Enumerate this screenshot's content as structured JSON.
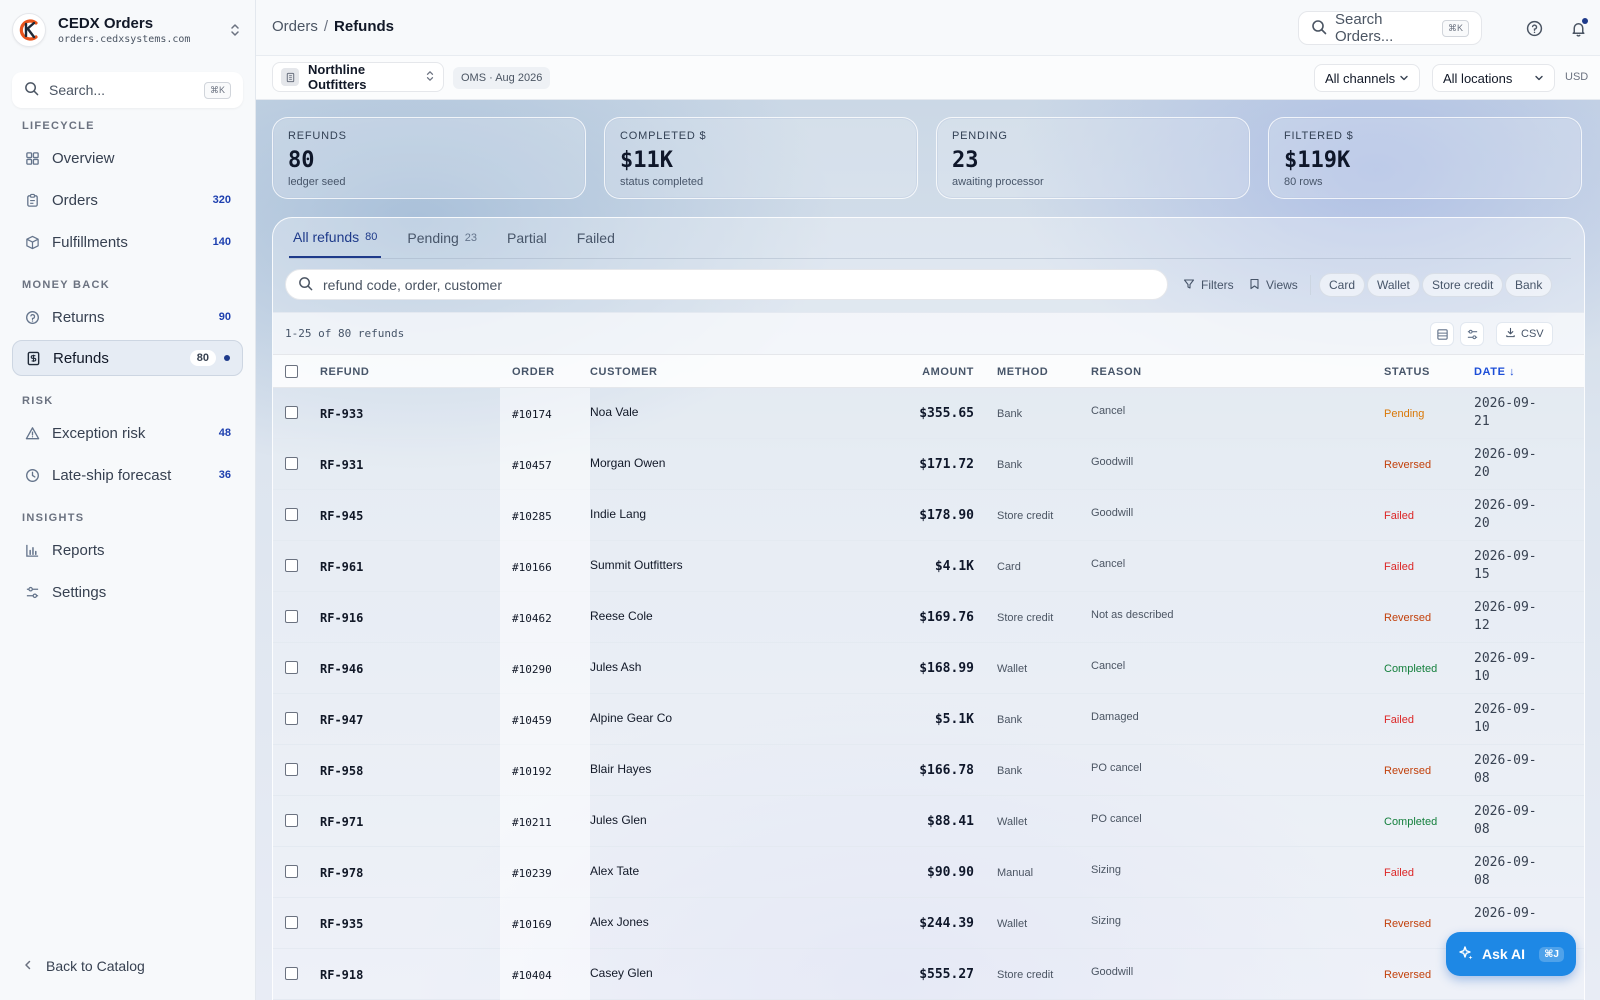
{
  "brand": {
    "name": "CEDX Orders",
    "domain": "orders.cedxsystems.com",
    "accent": "#e8541c"
  },
  "sidebar": {
    "search": {
      "placeholder": "Search...",
      "shortcut": "⌘K"
    },
    "sections": {
      "lifecycle": "LIFECYCLE",
      "money_back": "MONEY BACK",
      "risk": "RISK",
      "insights": "INSIGHTS"
    },
    "items": [
      {
        "label": "Overview",
        "count": "",
        "icon": "grid-icon"
      },
      {
        "label": "Orders",
        "count": "320",
        "icon": "clipboard-icon"
      },
      {
        "label": "Fulfillments",
        "count": "140",
        "icon": "box-icon"
      },
      {
        "label": "Returns",
        "count": "90",
        "icon": "return-circle-icon"
      },
      {
        "label": "Refunds",
        "count": "80",
        "icon": "receipt-dollar-icon",
        "active": true
      },
      {
        "label": "Exception risk",
        "count": "48",
        "icon": "warning-triangle-icon"
      },
      {
        "label": "Late-ship forecast",
        "count": "36",
        "icon": "clock-icon"
      },
      {
        "label": "Reports",
        "count": "",
        "icon": "bar-chart-icon"
      },
      {
        "label": "Settings",
        "count": "",
        "icon": "sliders-icon"
      }
    ],
    "back_label": "Back to Catalog"
  },
  "topbar": {
    "breadcrumb_parent": "Orders",
    "breadcrumb_sep": "/",
    "breadcrumb_current": "Refunds",
    "search_placeholder": "Search Orders...",
    "search_shortcut": "⌘K"
  },
  "subbar": {
    "org": "Northline Outfitters",
    "badge": "OMS · Aug 2026",
    "channels": "All channels",
    "locations": "All locations",
    "currency": "USD"
  },
  "kpis": [
    {
      "label": "REFUNDS",
      "value": "80",
      "sub": "ledger seed"
    },
    {
      "label": "COMPLETED $",
      "value": "$11K",
      "sub": "status completed"
    },
    {
      "label": "PENDING",
      "value": "23",
      "sub": "awaiting processor"
    },
    {
      "label": "FILTERED $",
      "value": "$119K",
      "sub": "80 rows"
    }
  ],
  "tabs": [
    {
      "label": "All refunds",
      "count": "80",
      "active": true
    },
    {
      "label": "Pending",
      "count": "23"
    },
    {
      "label": "Partial",
      "count": ""
    },
    {
      "label": "Failed",
      "count": ""
    }
  ],
  "table_controls": {
    "search_placeholder": "refund code, order, customer",
    "filters_label": "Filters",
    "views_label": "Views",
    "chips": [
      "Card",
      "Wallet",
      "Store credit",
      "Bank"
    ],
    "range_text": "1-25 of 80 refunds",
    "csv_label": "CSV"
  },
  "table": {
    "columns": {
      "refund": "REFUND",
      "order": "ORDER",
      "customer": "CUSTOMER",
      "amount": "AMOUNT",
      "method": "METHOD",
      "reason": "REASON",
      "status": "STATUS",
      "date": "DATE ↓"
    },
    "rows": [
      {
        "refund": "RF-933",
        "order": "#10174",
        "customer": "Noa Vale",
        "amount": "$355.65",
        "method": "Bank",
        "reason": "Cancel",
        "status": "Pending",
        "date": "2026-09-21"
      },
      {
        "refund": "RF-931",
        "order": "#10457",
        "customer": "Morgan Owen",
        "amount": "$171.72",
        "method": "Bank",
        "reason": "Goodwill",
        "status": "Reversed",
        "date": "2026-09-20"
      },
      {
        "refund": "RF-945",
        "order": "#10285",
        "customer": "Indie Lang",
        "amount": "$178.90",
        "method": "Store credit",
        "reason": "Goodwill",
        "status": "Failed",
        "date": "2026-09-20"
      },
      {
        "refund": "RF-961",
        "order": "#10166",
        "customer": "Summit Outfitters",
        "amount": "$4.1K",
        "method": "Card",
        "reason": "Cancel",
        "status": "Failed",
        "date": "2026-09-15"
      },
      {
        "refund": "RF-916",
        "order": "#10462",
        "customer": "Reese Cole",
        "amount": "$169.76",
        "method": "Store credit",
        "reason": "Not as described",
        "status": "Reversed",
        "date": "2026-09-12"
      },
      {
        "refund": "RF-946",
        "order": "#10290",
        "customer": "Jules Ash",
        "amount": "$168.99",
        "method": "Wallet",
        "reason": "Cancel",
        "status": "Completed",
        "date": "2026-09-10"
      },
      {
        "refund": "RF-947",
        "order": "#10459",
        "customer": "Alpine Gear Co",
        "amount": "$5.1K",
        "method": "Bank",
        "reason": "Damaged",
        "status": "Failed",
        "date": "2026-09-10"
      },
      {
        "refund": "RF-958",
        "order": "#10192",
        "customer": "Blair Hayes",
        "amount": "$166.78",
        "method": "Bank",
        "reason": "PO cancel",
        "status": "Reversed",
        "date": "2026-09-08"
      },
      {
        "refund": "RF-971",
        "order": "#10211",
        "customer": "Jules Glen",
        "amount": "$88.41",
        "method": "Wallet",
        "reason": "PO cancel",
        "status": "Completed",
        "date": "2026-09-08"
      },
      {
        "refund": "RF-978",
        "order": "#10239",
        "customer": "Alex Tate",
        "amount": "$90.90",
        "method": "Manual",
        "reason": "Sizing",
        "status": "Failed",
        "date": "2026-09-08"
      },
      {
        "refund": "RF-935",
        "order": "#10169",
        "customer": "Alex Jones",
        "amount": "$244.39",
        "method": "Wallet",
        "reason": "Sizing",
        "status": "Reversed",
        "date": "2026-09-"
      },
      {
        "refund": "RF-918",
        "order": "#10404",
        "customer": "Casey Glen",
        "amount": "$555.27",
        "method": "Store credit",
        "reason": "Goodwill",
        "status": "Reversed",
        "date": "27"
      }
    ]
  },
  "status_colors": {
    "Pending": "#d97706",
    "Reversed": "#c2410c",
    "Failed": "#dc2626",
    "Completed": "#15803d"
  },
  "ask_ai": {
    "label": "Ask AI",
    "shortcut": "⌘J"
  }
}
